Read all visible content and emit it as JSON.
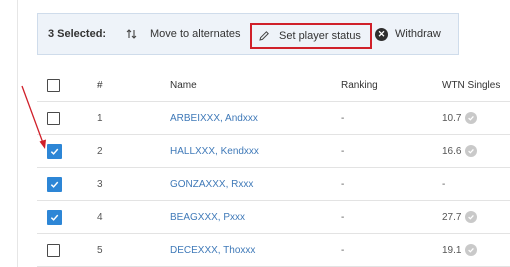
{
  "action_bar": {
    "selected_count": "3 Selected:",
    "move_label": "Move to alternates",
    "status_label": "Set player status",
    "withdraw_label": "Withdraw",
    "highlight_color": "#d0202a"
  },
  "table": {
    "headers": {
      "number": "#",
      "name": "Name",
      "ranking": "Ranking",
      "wtn": "WTN Singles"
    },
    "rows": [
      {
        "num": "1",
        "name": "ARBEIXXX, Andxxx",
        "ranking": "-",
        "wtn": "10.7",
        "checked": false
      },
      {
        "num": "2",
        "name": "HALLXXX, Kendxxx",
        "ranking": "-",
        "wtn": "16.6",
        "checked": true
      },
      {
        "num": "3",
        "name": "GONZAXXX, Rxxx",
        "ranking": "-",
        "wtn": "-",
        "checked": true
      },
      {
        "num": "4",
        "name": "BEAGXXX, Pxxx",
        "ranking": "-",
        "wtn": "27.7",
        "checked": true
      },
      {
        "num": "5",
        "name": "DECEXXX, Thoxxx",
        "ranking": "-",
        "wtn": "19.1",
        "checked": false
      }
    ]
  },
  "colors": {
    "link": "#3f79b8",
    "checkbox_checked": "#2d86d6",
    "annotation_arrow": "#d0202a"
  }
}
